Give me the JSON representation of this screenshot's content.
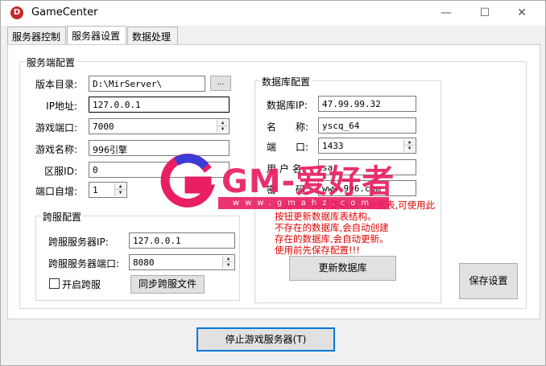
{
  "window": {
    "title": "GameCenter",
    "icon_letter": "D"
  },
  "tabs": [
    {
      "label": "服务器控制",
      "active": false
    },
    {
      "label": "服务器设置",
      "active": true
    },
    {
      "label": "数据处理",
      "active": false
    }
  ],
  "server_config": {
    "title": "服务端配置",
    "version_dir_label": "版本目录:",
    "version_dir_value": "D:\\MirServer\\",
    "browse_label": "...",
    "ip_label": "IP地址:",
    "ip_value": "127.0.0.1",
    "port_label": "游戏端口:",
    "port_value": "7000",
    "game_name_label": "游戏名称:",
    "game_name_value": "996引擎",
    "zone_id_label": "区服ID:",
    "zone_id_value": "0",
    "port_inc_label": "端口自增:",
    "port_inc_value": "1"
  },
  "cross_config": {
    "title": "跨服配置",
    "server_ip_label": "跨服服务器IP:",
    "server_ip_value": "127.0.0.1",
    "server_port_label": "跨服服务器端口:",
    "server_port_value": "8080",
    "enable_label": "开启跨服",
    "enable_checked": false,
    "sync_button": "同步跨服文件"
  },
  "db_config": {
    "title": "数据库配置",
    "ip_label": "数据库IP:",
    "ip_value": "47.99.99.32",
    "name_label": "名　　称:",
    "name_value": "yscq_64",
    "port_label": "端　　口:",
    "port_value": "1433",
    "user_label": "用 户 名:",
    "user_value": "sa",
    "pwd_label": "密　　码:",
    "pwd_value": "www.996.com",
    "note_lines": [
      "使用本功能将更新以下数据表,可使用此",
      "按钮更新数据库表结构。",
      "不存在的数据库,会自动创建",
      "存在的数据库,会自动更新。",
      "使用前先保存配置!!!"
    ],
    "update_button": "更新数据库"
  },
  "save_button": "保存设置",
  "stop_button": "停止游戏服务器(T)",
  "watermark": {
    "text": "GM-爱好者",
    "sub": "www.gmahz.com",
    "color": "#e91e63"
  }
}
